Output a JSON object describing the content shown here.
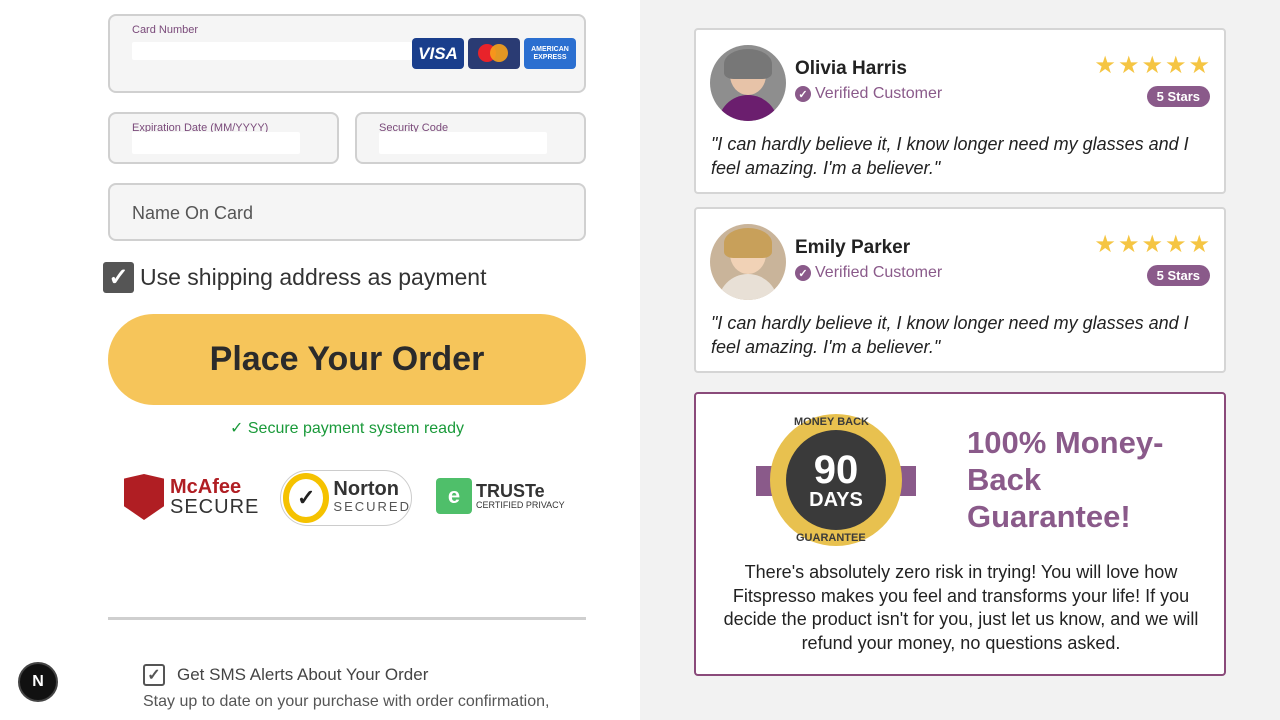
{
  "payment_form": {
    "card_number_label": "Card Number",
    "card_logos": [
      "VISA",
      "mastercard",
      "AMERICAN EXPRESS"
    ],
    "expiration_label": "Expiration Date (MM/YYYY)",
    "security_code_label": "Security Code",
    "name_on_card_placeholder": "Name On Card",
    "use_shipping_label": "Use shipping address as payment",
    "use_shipping_checked": true,
    "place_order_label": "Place Your Order",
    "secure_message": "✓ Secure payment system ready"
  },
  "trust_badges": {
    "mcafee_line1": "McAfee",
    "mcafee_line2": "SECURE",
    "norton_line1": "Norton",
    "norton_line2": "SECURED",
    "truste_line1": "TRUSTe",
    "truste_line2": "CERTIFIED PRIVACY"
  },
  "sms": {
    "label": "Get SMS Alerts About Your Order",
    "checked": true,
    "description": "Stay up to date on your purchase with order confirmation,"
  },
  "next_badge": "N",
  "reviews": [
    {
      "name": "Olivia Harris",
      "verified": "Verified Customer",
      "stars": 5,
      "stars_badge": "5 Stars",
      "quote": "\"I can hardly believe it, I know longer need my glasses and I feel amazing. I'm a believer.\""
    },
    {
      "name": "Emily Parker",
      "verified": "Verified Customer",
      "stars": 5,
      "stars_badge": "5 Stars",
      "quote": "\"I can hardly believe it, I know longer need my glasses and I feel amazing. I'm a believer.\""
    }
  ],
  "guarantee": {
    "seal_top": "MONEY BACK",
    "seal_number": "90",
    "seal_days": "DAYS",
    "seal_bottom": "GUARANTEE",
    "title": "100% Money-Back Guarantee!",
    "text": "There's absolutely zero risk in trying! You will love how Fitspresso makes you feel and transforms your life! If you decide the product isn't for you, just let us know, and we will refund your money, no questions asked."
  },
  "colors": {
    "accent_purple": "#8a5a8a",
    "button_yellow": "#f6c55a",
    "secure_green": "#1a9a3a",
    "star_gold": "#f5c543"
  }
}
